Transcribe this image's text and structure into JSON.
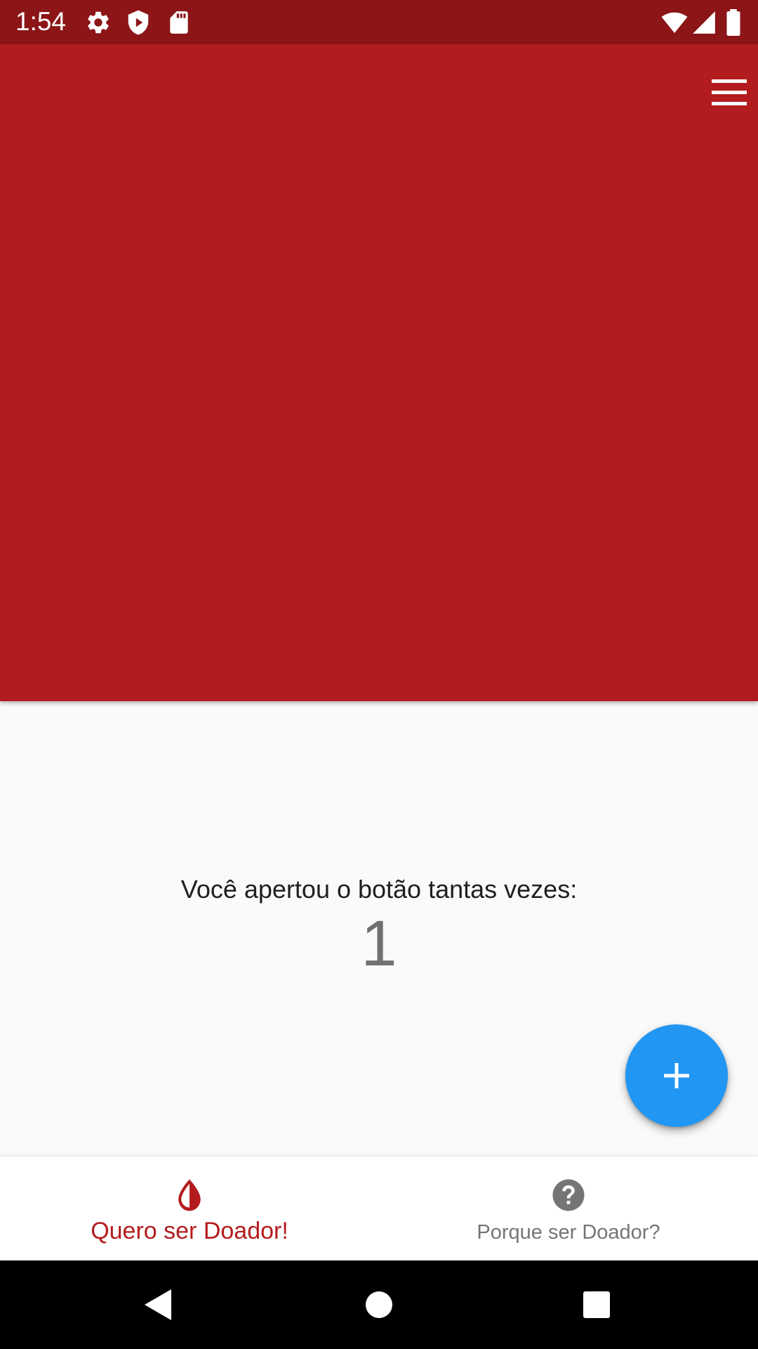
{
  "status_bar": {
    "time": "1:54",
    "icons": [
      "settings-icon",
      "shield-icon",
      "sd-card-icon",
      "wifi-icon",
      "signal-icon",
      "battery-icon"
    ],
    "background_color": "#8b1517"
  },
  "header": {
    "background_color": "#b31c1e",
    "menu_icon": "menu-icon"
  },
  "main": {
    "counter_label": "Você apertou o botão tantas vezes:",
    "counter_value": "1"
  },
  "fab": {
    "icon": "plus-icon",
    "color": "#2196f3"
  },
  "bottom_nav": {
    "items": [
      {
        "label": "Quero ser Doador!",
        "icon": "blood-drop-icon",
        "active": true,
        "color": "#b31c1e"
      },
      {
        "label": "Porque ser Doador?",
        "icon": "help-circle-icon",
        "active": false,
        "color": "#757575"
      }
    ]
  },
  "system_nav": {
    "buttons": [
      "back-icon",
      "home-icon",
      "recents-icon"
    ]
  }
}
